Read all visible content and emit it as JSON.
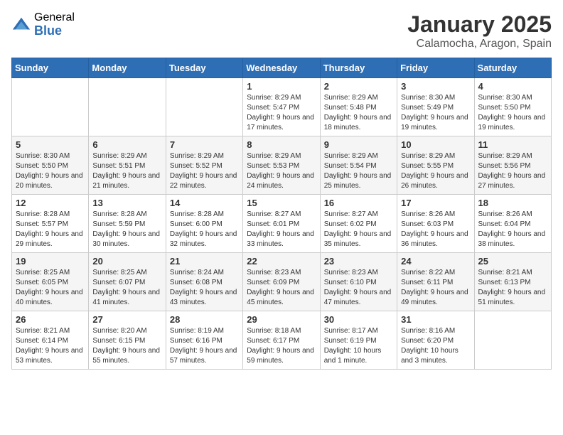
{
  "logo": {
    "general": "General",
    "blue": "Blue"
  },
  "header": {
    "month": "January 2025",
    "location": "Calamocha, Aragon, Spain"
  },
  "weekdays": [
    "Sunday",
    "Monday",
    "Tuesday",
    "Wednesday",
    "Thursday",
    "Friday",
    "Saturday"
  ],
  "weeks": [
    [
      {
        "day": "",
        "empty": true
      },
      {
        "day": "",
        "empty": true
      },
      {
        "day": "",
        "empty": true
      },
      {
        "day": "1",
        "sunrise": "8:29 AM",
        "sunset": "5:47 PM",
        "daylight": "9 hours and 17 minutes."
      },
      {
        "day": "2",
        "sunrise": "8:29 AM",
        "sunset": "5:48 PM",
        "daylight": "9 hours and 18 minutes."
      },
      {
        "day": "3",
        "sunrise": "8:30 AM",
        "sunset": "5:49 PM",
        "daylight": "9 hours and 19 minutes."
      },
      {
        "day": "4",
        "sunrise": "8:30 AM",
        "sunset": "5:50 PM",
        "daylight": "9 hours and 19 minutes."
      }
    ],
    [
      {
        "day": "5",
        "sunrise": "8:30 AM",
        "sunset": "5:50 PM",
        "daylight": "9 hours and 20 minutes."
      },
      {
        "day": "6",
        "sunrise": "8:29 AM",
        "sunset": "5:51 PM",
        "daylight": "9 hours and 21 minutes."
      },
      {
        "day": "7",
        "sunrise": "8:29 AM",
        "sunset": "5:52 PM",
        "daylight": "9 hours and 22 minutes."
      },
      {
        "day": "8",
        "sunrise": "8:29 AM",
        "sunset": "5:53 PM",
        "daylight": "9 hours and 24 minutes."
      },
      {
        "day": "9",
        "sunrise": "8:29 AM",
        "sunset": "5:54 PM",
        "daylight": "9 hours and 25 minutes."
      },
      {
        "day": "10",
        "sunrise": "8:29 AM",
        "sunset": "5:55 PM",
        "daylight": "9 hours and 26 minutes."
      },
      {
        "day": "11",
        "sunrise": "8:29 AM",
        "sunset": "5:56 PM",
        "daylight": "9 hours and 27 minutes."
      }
    ],
    [
      {
        "day": "12",
        "sunrise": "8:28 AM",
        "sunset": "5:57 PM",
        "daylight": "9 hours and 29 minutes."
      },
      {
        "day": "13",
        "sunrise": "8:28 AM",
        "sunset": "5:59 PM",
        "daylight": "9 hours and 30 minutes."
      },
      {
        "day": "14",
        "sunrise": "8:28 AM",
        "sunset": "6:00 PM",
        "daylight": "9 hours and 32 minutes."
      },
      {
        "day": "15",
        "sunrise": "8:27 AM",
        "sunset": "6:01 PM",
        "daylight": "9 hours and 33 minutes."
      },
      {
        "day": "16",
        "sunrise": "8:27 AM",
        "sunset": "6:02 PM",
        "daylight": "9 hours and 35 minutes."
      },
      {
        "day": "17",
        "sunrise": "8:26 AM",
        "sunset": "6:03 PM",
        "daylight": "9 hours and 36 minutes."
      },
      {
        "day": "18",
        "sunrise": "8:26 AM",
        "sunset": "6:04 PM",
        "daylight": "9 hours and 38 minutes."
      }
    ],
    [
      {
        "day": "19",
        "sunrise": "8:25 AM",
        "sunset": "6:05 PM",
        "daylight": "9 hours and 40 minutes."
      },
      {
        "day": "20",
        "sunrise": "8:25 AM",
        "sunset": "6:07 PM",
        "daylight": "9 hours and 41 minutes."
      },
      {
        "day": "21",
        "sunrise": "8:24 AM",
        "sunset": "6:08 PM",
        "daylight": "9 hours and 43 minutes."
      },
      {
        "day": "22",
        "sunrise": "8:23 AM",
        "sunset": "6:09 PM",
        "daylight": "9 hours and 45 minutes."
      },
      {
        "day": "23",
        "sunrise": "8:23 AM",
        "sunset": "6:10 PM",
        "daylight": "9 hours and 47 minutes."
      },
      {
        "day": "24",
        "sunrise": "8:22 AM",
        "sunset": "6:11 PM",
        "daylight": "9 hours and 49 minutes."
      },
      {
        "day": "25",
        "sunrise": "8:21 AM",
        "sunset": "6:13 PM",
        "daylight": "9 hours and 51 minutes."
      }
    ],
    [
      {
        "day": "26",
        "sunrise": "8:21 AM",
        "sunset": "6:14 PM",
        "daylight": "9 hours and 53 minutes."
      },
      {
        "day": "27",
        "sunrise": "8:20 AM",
        "sunset": "6:15 PM",
        "daylight": "9 hours and 55 minutes."
      },
      {
        "day": "28",
        "sunrise": "8:19 AM",
        "sunset": "6:16 PM",
        "daylight": "9 hours and 57 minutes."
      },
      {
        "day": "29",
        "sunrise": "8:18 AM",
        "sunset": "6:17 PM",
        "daylight": "9 hours and 59 minutes."
      },
      {
        "day": "30",
        "sunrise": "8:17 AM",
        "sunset": "6:19 PM",
        "daylight": "10 hours and 1 minute."
      },
      {
        "day": "31",
        "sunrise": "8:16 AM",
        "sunset": "6:20 PM",
        "daylight": "10 hours and 3 minutes."
      },
      {
        "day": "",
        "empty": true
      }
    ]
  ]
}
